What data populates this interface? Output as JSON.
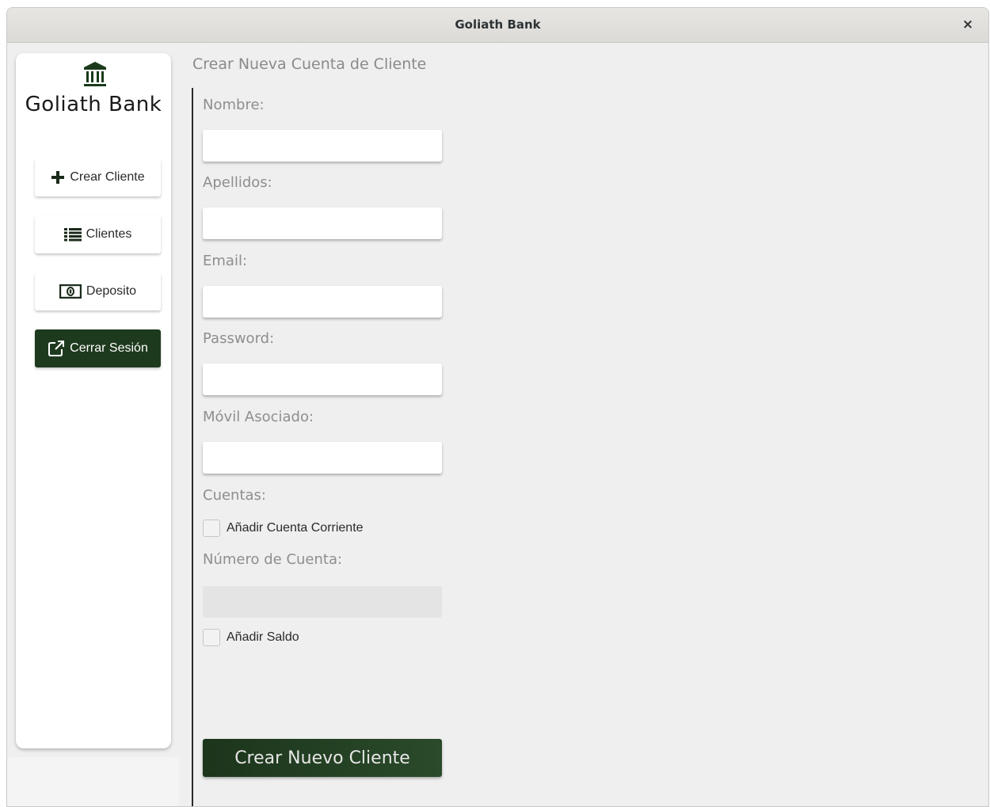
{
  "window": {
    "title": "Goliath Bank",
    "close_glyph": "×"
  },
  "sidebar": {
    "brand": "Goliath Bank",
    "logo_icon": "bank-icon",
    "items": [
      {
        "label": "Crear Cliente",
        "icon": "plus-icon"
      },
      {
        "label": "Clientes",
        "icon": "list-icon"
      },
      {
        "label": "Deposito",
        "icon": "money-icon"
      },
      {
        "label": "Cerrar Sesión",
        "icon": "external-link-icon"
      }
    ]
  },
  "form": {
    "title": "Crear Nueva Cuenta de Cliente",
    "nombre_label": "Nombre:",
    "apellidos_label": "Apellidos:",
    "email_label": "Email:",
    "password_label": "Password:",
    "movil_label": "Móvil Asociado:",
    "cuentas_label": "Cuentas:",
    "add_cuenta_corriente": "Añadir Cuenta Corriente",
    "numero_cuenta_label": "Número de Cuenta:",
    "add_saldo": "Añadir Saldo",
    "submit": "Crear Nuevo Cliente",
    "values": {
      "nombre": "",
      "apellidos": "",
      "email": "",
      "password": "",
      "movil": "",
      "numero_cuenta": ""
    }
  },
  "colors": {
    "accent": "#1e3a1e",
    "background": "#efefef",
    "label": "#8e8e8e"
  }
}
